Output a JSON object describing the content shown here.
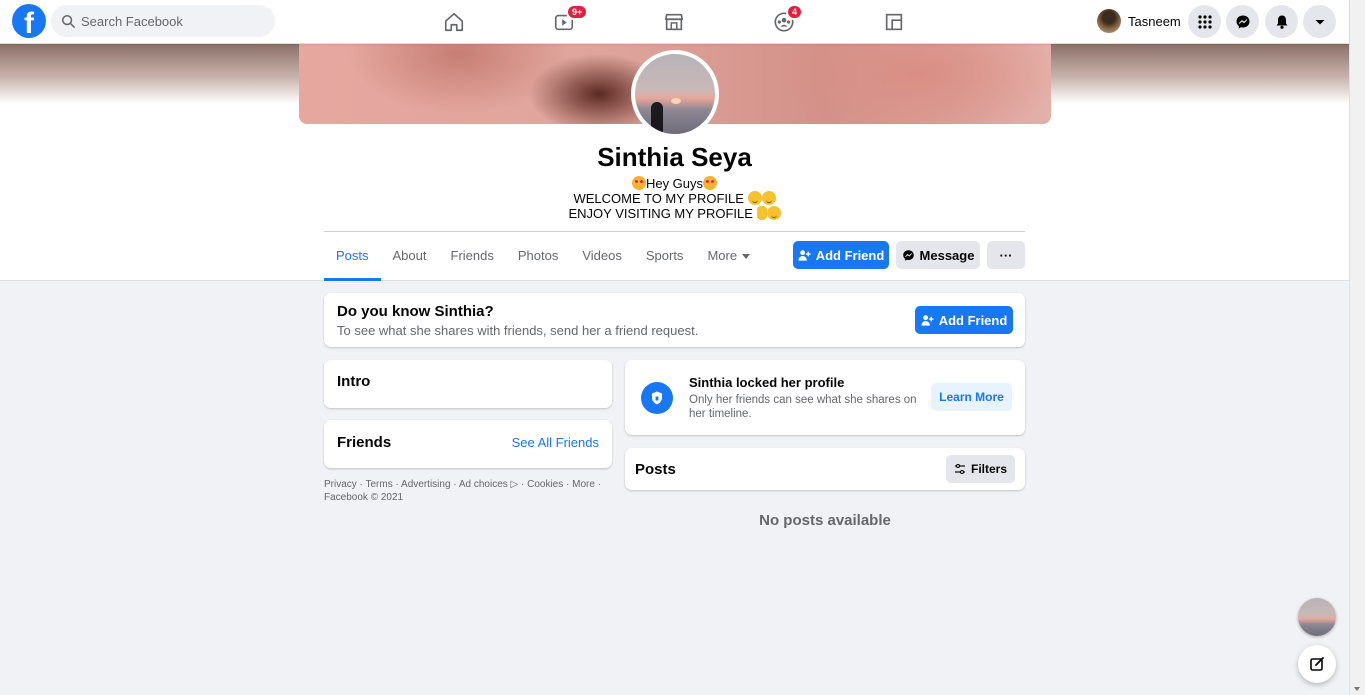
{
  "topnav": {
    "logo": "f",
    "search_placeholder": "Search Facebook",
    "tabs": [
      {
        "icon": "home-icon"
      },
      {
        "icon": "watch-icon",
        "badge": "9+"
      },
      {
        "icon": "marketplace-icon"
      },
      {
        "icon": "groups-icon",
        "badge": "4"
      },
      {
        "icon": "gaming-icon"
      }
    ],
    "user_name": "Tasneem",
    "right_icons": [
      "menu-grid-icon",
      "messenger-icon",
      "notifications-icon",
      "account-dropdown-icon"
    ]
  },
  "profile": {
    "name": "Sinthia Seya",
    "bio_line1": "Hey Guys",
    "bio_line2": "WELCOME TO MY PROFILE ",
    "bio_line3": "ENJOY VISITING MY PROFILE "
  },
  "tabs": [
    "Posts",
    "About",
    "Friends",
    "Photos",
    "Videos",
    "Sports",
    "More"
  ],
  "actions": {
    "add_friend": "Add Friend",
    "message": "Message",
    "more": "···"
  },
  "know_card": {
    "title": "Do you know Sinthia?",
    "subtitle": "To see what she shares with friends, send her a friend request.",
    "button": "Add Friend"
  },
  "intro": {
    "title": "Intro"
  },
  "friends": {
    "title": "Friends",
    "link": "See All Friends"
  },
  "footer": {
    "line1": "Privacy · Terms · Advertising · Ad choices ▷ · Cookies · More ·",
    "line2": "Facebook © 2021"
  },
  "locked": {
    "title": "Sinthia locked her profile",
    "subtitle": "Only her friends can see what she shares on her timeline.",
    "button": "Learn More"
  },
  "posts": {
    "title": "Posts",
    "filters": "Filters",
    "empty": "No posts available"
  },
  "colors": {
    "accent": "#1877f2",
    "badge": "#e41e3f",
    "background": "#f0f2f5"
  }
}
